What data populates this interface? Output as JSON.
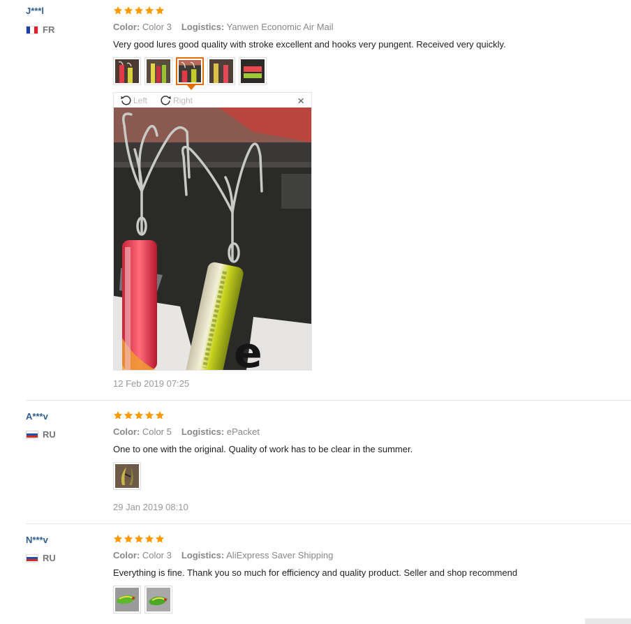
{
  "labels": {
    "color": "Color:",
    "logistics": "Logistics:"
  },
  "viewer": {
    "left_label": "Left",
    "right_label": "Right",
    "close_symbol": "×"
  },
  "colors": {
    "star": "#f90",
    "link": "#2f5e8d",
    "active_border": "#e56a00"
  },
  "reviews": [
    {
      "user": "J***l",
      "country": "FR",
      "flag": "france-flag-icon",
      "rating": 5,
      "color": "Color 3",
      "logistics": "Yanwen Economic Air Mail",
      "text": "Very good lures good quality with stroke excellent and hooks very pungent. Received very quickly.",
      "photo_count": 5,
      "selected_photo": 3,
      "date": "12 Feb 2019 07:25"
    },
    {
      "user": "A***v",
      "country": "RU",
      "flag": "russia-flag-icon",
      "rating": 5,
      "color": "Color 5",
      "logistics": "ePacket",
      "text": "One to one with the original. Quality of work has to be clear in the summer.",
      "photo_count": 1,
      "date": "29 Jan 2019 08:10"
    },
    {
      "user": "N***v",
      "country": "RU",
      "flag": "russia-flag-icon",
      "rating": 5,
      "color": "Color 3",
      "logistics": "AliExpress Saver Shipping",
      "text": "Everything is fine. Thank you so much for efficiency and quality product. Seller and shop recommend",
      "photo_count": 2
    }
  ]
}
